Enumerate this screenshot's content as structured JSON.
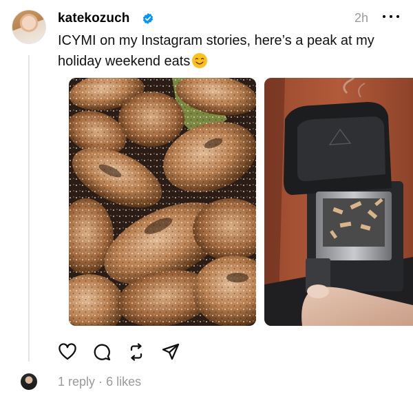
{
  "post": {
    "username": "katekozuch",
    "time": "2h",
    "caption": "ICYMI on my Instagram stories, here’s a peak at my holiday weekend eats",
    "caption_emoji": "smiling-face-emoji",
    "verified_color": "#0095f6"
  },
  "media": [
    {
      "name": "wings-photo"
    },
    {
      "name": "smoker-box-photo"
    }
  ],
  "actions": [
    "like-icon",
    "reply-icon",
    "repost-icon",
    "share-icon"
  ],
  "stats": {
    "replies": "1 reply",
    "separator": "·",
    "likes": "6 likes"
  }
}
